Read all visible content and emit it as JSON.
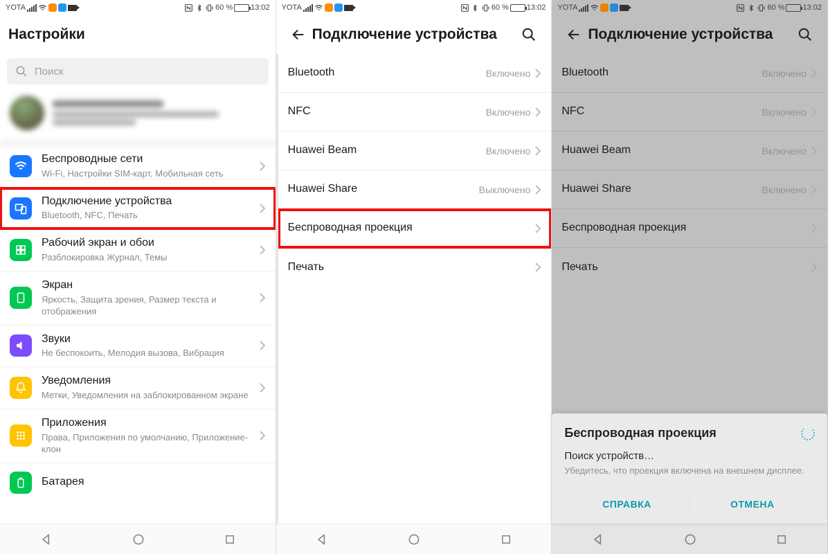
{
  "status": {
    "carrier": "YOTA",
    "battery_pct": "60 %",
    "time": "13:02"
  },
  "p1": {
    "title": "Настройки",
    "search_placeholder": "Поиск",
    "items": [
      {
        "title": "Беспроводные сети",
        "sub": "Wi-Fi, Настройки SIM-карт, Мобильная сеть"
      },
      {
        "title": "Подключение устройства",
        "sub": "Bluetooth, NFC, Печать"
      },
      {
        "title": "Рабочий экран и обои",
        "sub": "Разблокировка Журнал, Темы"
      },
      {
        "title": "Экран",
        "sub": "Яркость, Защита зрения, Размер текста и отображения"
      },
      {
        "title": "Звуки",
        "sub": "Не беспокоить, Мелодия вызова, Вибрация"
      },
      {
        "title": "Уведомления",
        "sub": "Метки, Уведомления на заблокированном экране"
      },
      {
        "title": "Приложения",
        "sub": "Права, Приложения по умолчанию, Приложение-клон"
      },
      {
        "title": "Батарея",
        "sub": ""
      }
    ]
  },
  "p2": {
    "title": "Подключение устройства",
    "items": [
      {
        "title": "Bluetooth",
        "value": "Включено"
      },
      {
        "title": "NFC",
        "value": "Включено"
      },
      {
        "title": "Huawei Beam",
        "value": "Включено"
      },
      {
        "title": "Huawei Share",
        "value": "Выключено"
      },
      {
        "title": "Беспроводная проекция",
        "value": ""
      },
      {
        "title": "Печать",
        "value": ""
      }
    ]
  },
  "p3": {
    "title": "Подключение устройства",
    "items": [
      {
        "title": "Bluetooth",
        "value": "Включено"
      },
      {
        "title": "NFC",
        "value": "Включено"
      },
      {
        "title": "Huawei Beam",
        "value": "Включено"
      },
      {
        "title": "Huawei Share",
        "value": "Включено"
      },
      {
        "title": "Беспроводная проекция",
        "value": ""
      },
      {
        "title": "Печать",
        "value": ""
      }
    ],
    "sheet": {
      "title": "Беспроводная проекция",
      "searching": "Поиск устройств…",
      "desc": "Убедитесь, что проекция включена на внешнем дисплее.",
      "help": "СПРАВКА",
      "cancel": "ОТМЕНА"
    }
  }
}
